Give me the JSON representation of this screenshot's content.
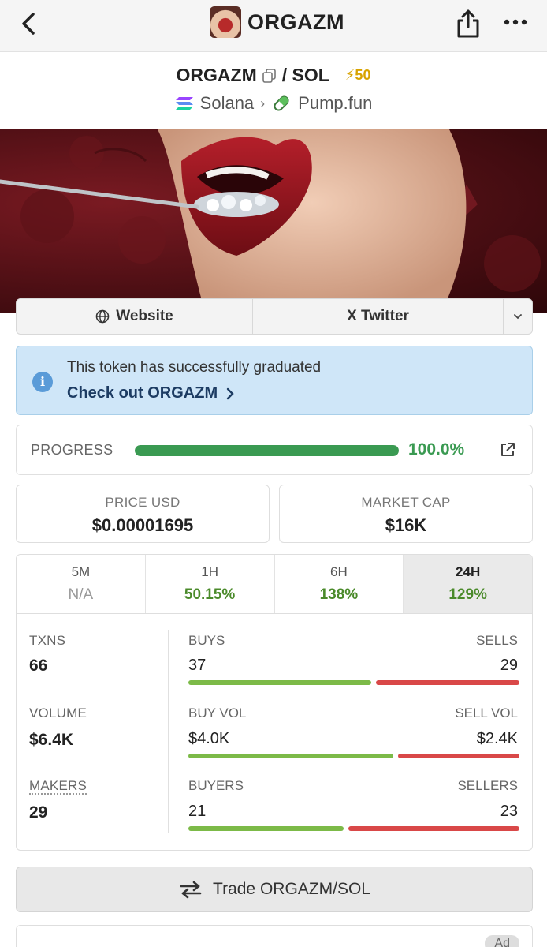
{
  "nav": {
    "title": "ORGAZM"
  },
  "pair": {
    "base": "ORGAZM",
    "separator": "/ SOL",
    "boost": "⚡50",
    "chain": "Solana",
    "dex": "Pump.fun"
  },
  "links": {
    "website": "Website",
    "twitter": "X Twitter"
  },
  "notice": {
    "text": "This token has successfully graduated",
    "link": "Check out ORGAZM"
  },
  "progress": {
    "label": "PROGRESS",
    "value_text": "100.0%",
    "fraction": 1.0
  },
  "stats": {
    "price_label": "PRICE USD",
    "price_value": "$0.00001695",
    "mcap_label": "MARKET CAP",
    "mcap_value": "$16K"
  },
  "timeframes": [
    {
      "name": "5M",
      "value": "N/A"
    },
    {
      "name": "1H",
      "value": "50.15%"
    },
    {
      "name": "6H",
      "value": "138%"
    },
    {
      "name": "24H",
      "value": "129%",
      "active": true
    }
  ],
  "tx": {
    "txns_label": "TXNS",
    "txns_value": "66",
    "volume_label": "VOLUME",
    "volume_value": "$6.4K",
    "makers_label": "MAKERS",
    "makers_value": "29",
    "buys_label": "BUYS",
    "buys_value": "37",
    "sells_label": "SELLS",
    "sells_value": "29",
    "buy_vol_label": "BUY VOL",
    "buy_vol_value": "$4.0K",
    "sell_vol_label": "SELL VOL",
    "sell_vol_value": "$2.4K",
    "buyers_label": "BUYERS",
    "buyers_value": "21",
    "sellers_label": "SELLERS",
    "sellers_value": "23",
    "ratios": {
      "txns_buy_fraction": 0.56,
      "vol_buy_fraction": 0.625,
      "makers_buy_fraction": 0.477
    }
  },
  "trade": {
    "label": "Trade ORGAZM/SOL"
  },
  "ad": {
    "badge": "Ad"
  },
  "colors": {
    "green": "#3a9a52",
    "buy_bar": "#7cba48",
    "sell_bar": "#d94848",
    "notice_bg": "#cfe6f8"
  }
}
